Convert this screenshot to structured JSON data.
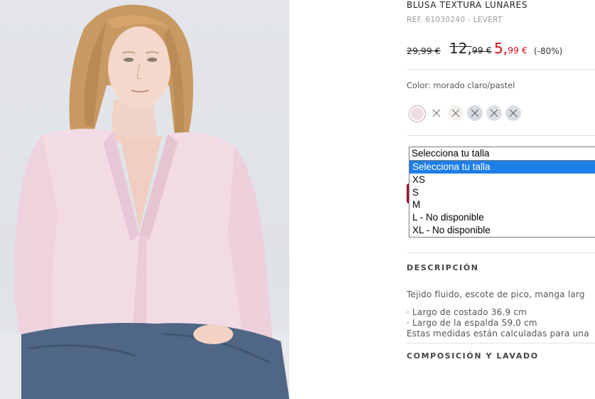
{
  "product": {
    "title": "BLUSA TEXTURA LUNARES",
    "ref": "REF. 61030240 - LEVERT"
  },
  "prices": {
    "old_price_1": "29,99 €",
    "old_price_2_int": "12,",
    "old_price_2_dec": "99 €",
    "new_price_int": "5,",
    "new_price_dec": "99 €",
    "discount": "(-80%)",
    "sale_color": "#d0101a"
  },
  "color": {
    "label": "Color: morado claro/pastel",
    "selected_swatch": "#f0dde3",
    "swatches": [
      {
        "name": "morado claro/pastel",
        "available": true
      },
      {
        "name": "unavailable",
        "available": false
      },
      {
        "name": "unavailable",
        "available": false
      },
      {
        "name": "unavailable",
        "available": false
      },
      {
        "name": "unavailable",
        "available": false
      },
      {
        "name": "unavailable",
        "available": false
      }
    ]
  },
  "size_select": {
    "value": "Selecciona tu talla",
    "options": [
      "Selecciona tu talla",
      "XS",
      "S",
      "M",
      "L - No disponible",
      "XL - No disponible"
    ],
    "highlighted_index": 0
  },
  "description": {
    "heading": "DESCRIPCIÓN",
    "text": "Tejido fluido, escote de pico, manga larg",
    "bullets": [
      "· Largo de costado 36.9 cm",
      "· Largo de la espalda 59.0 cm"
    ],
    "note": "Estas medidas están calculadas para una"
  },
  "composition": {
    "heading": "COMPOSICIÓN Y LAVADO"
  }
}
